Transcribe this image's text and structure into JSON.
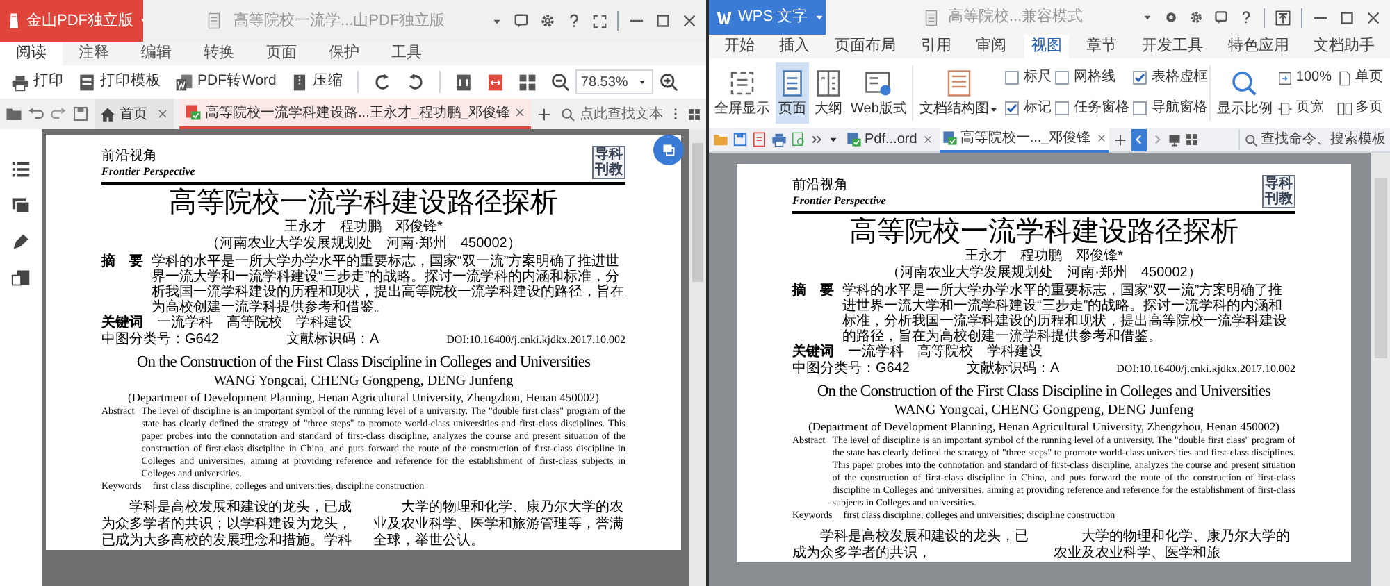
{
  "pdf_window": {
    "app_name": "金山PDF独立版",
    "title": "高等院校一流学...山PDF独立版",
    "ribbon_tabs": [
      {
        "label": "阅读",
        "selected": true
      },
      {
        "label": "注释",
        "selected": false
      },
      {
        "label": "编辑",
        "selected": false
      },
      {
        "label": "转换",
        "selected": false
      },
      {
        "label": "页面",
        "selected": false
      },
      {
        "label": "保护",
        "selected": false
      },
      {
        "label": "工具",
        "selected": false
      }
    ],
    "toolbar": [
      "打印",
      "打印模板",
      "PDF转Word",
      "压缩"
    ],
    "zoom": "78.53%",
    "doc_tabs": [
      {
        "label": "首页",
        "kind": "home",
        "selected": false
      },
      {
        "label": "高等院校一流学科建设路...王永才_程功鹏_邓俊锋",
        "kind": "file",
        "selected": true
      }
    ],
    "search_placeholder": "点此查找文本",
    "document": {
      "section_cn": "前沿视角",
      "section_en": "Frontier Perspective",
      "logo": [
        "导",
        "科",
        "刊",
        "教"
      ],
      "title": "高等院校一流学科建设路径探析",
      "authors": "王永才　程功鹏　邓俊锋*",
      "affiliation": "（河南农业大学发展规划处　河南·郑州　450002）",
      "abstract_label": "摘　要",
      "abstract": "学科的水平是一所大学办学水平的重要标志，国家“双一流”方案明确了推进世界一流大学和一流学科建设“三步走”的战略。探讨一流学科的内涵和标准，分析我国一流学科建设的历程和现状，提出高等院校一流学科建设的路径，旨在为高校创建一流学科提供参考和借鉴。",
      "keywords_label": "关键词",
      "keywords": [
        "一流学科",
        "高等院校",
        "学科建设"
      ],
      "classification": "中图分类号：G642",
      "doc_code": "文献标识码：A",
      "doi": "DOI:10.16400/j.cnki.kjdkx.2017.10.002",
      "en_title": "On the Construction of the First Class Discipline in Colleges and Universities",
      "en_authors": "WANG Yongcai, CHENG Gongpeng, DENG Junfeng",
      "en_affiliation": "(Department of Development Planning, Henan Agricultural University, Zhengzhou, Henan 450002)",
      "en_abstract_label": "Abstract",
      "en_abstract": "The level of discipline is an important symbol of the running level of a university. The \"double first class\" program of the state has clearly defined the strategy of \"three steps\" to promote world-class universities and first-class disciplines. This paper probes into the connotation and standard of first-class discipline, analyzes the course and present situation of the construction of first-class discipline in China, and puts forward the route of the construction of first-class discipline in Colleges and universities, aiming at providing reference and reference for the establishment of first-class subjects in Colleges and universities.",
      "en_keywords_label": "Keywords",
      "en_keywords": "first class discipline; colleges and universities; discipline construction",
      "body_columns": [
        "学科是高校发展和建设的龙头，已成为众多学者的共识；以学科建设为龙头，已成为大多高校的发展理念和措施。学科",
        "大学的物理和化学、康乃尔大学的农业及农业科学、医学和旅游管理等，誉满全球，举世公认。"
      ]
    }
  },
  "wps_window": {
    "app_name": "WPS 文字",
    "title": "高等院校...兼容模式",
    "ribbon_tabs": [
      {
        "label": "开始",
        "selected": false
      },
      {
        "label": "插入",
        "selected": false
      },
      {
        "label": "页面布局",
        "selected": false
      },
      {
        "label": "引用",
        "selected": false
      },
      {
        "label": "审阅",
        "selected": false
      },
      {
        "label": "视图",
        "selected": true
      },
      {
        "label": "章节",
        "selected": false
      },
      {
        "label": "开发工具",
        "selected": false
      },
      {
        "label": "特色应用",
        "selected": false
      },
      {
        "label": "文档助手",
        "selected": false
      }
    ],
    "view_buttons": [
      {
        "label": "全屏显示",
        "selected": false
      },
      {
        "label": "页面",
        "selected": true
      },
      {
        "label": "大纲",
        "selected": false
      },
      {
        "label": "Web版式",
        "selected": false
      }
    ],
    "structure_button": "文档结构图",
    "checkboxes": [
      {
        "label": "标尺",
        "checked": false
      },
      {
        "label": "网格线",
        "checked": false
      },
      {
        "label": "表格虚框",
        "checked": true
      },
      {
        "label": "标记",
        "checked": true
      },
      {
        "label": "任务窗格",
        "checked": false
      },
      {
        "label": "导航窗格",
        "checked": false
      }
    ],
    "zoom_button": "显示比例",
    "zoom_options": [
      "100%",
      "页宽"
    ],
    "page_options": [
      "单页",
      "多页"
    ],
    "doc_tabs": [
      {
        "label": "Pdf...ord",
        "selected": false
      },
      {
        "label": "高等院校一..._邓俊锋",
        "selected": true
      }
    ],
    "search_placeholder": "查找命令、搜索模板",
    "document": {
      "section_cn": "前沿视角",
      "section_en": "Frontier Perspective",
      "logo": [
        "导",
        "科",
        "刊",
        "教"
      ],
      "title": "高等院校一流学科建设路径探析",
      "authors": "王永才　程功鹏　邓俊锋*",
      "affiliation": "（河南农业大学发展规划处　河南·郑州　450002）",
      "abstract_label": "摘　要",
      "abstract": "学科的水平是一所大学办学水平的重要标志，国家“双一流”方案明确了推进世界一流大学和一流学科建设“三步走”的战略。探讨一流学科的内涵和标准，分析我国一流学科建设的历程和现状，提出高等院校一流学科建设的路径，旨在为高校创建一流学科提供参考和借鉴。",
      "keywords_label": "关键词",
      "keywords": [
        "一流学科",
        "高等院校",
        "学科建设"
      ],
      "classification": "中图分类号：G642",
      "doc_code": "文献标识码：A",
      "doi": "DOI:10.16400/j.cnki.kjdkx.2017.10.002",
      "en_title": "On the Construction of the First Class Discipline in Colleges and Universities",
      "en_authors": "WANG Yongcai, CHENG Gongpeng, DENG Junfeng",
      "en_affiliation": "(Department of Development Planning, Henan Agricultural University, Zhengzhou, Henan 450002)",
      "en_abstract_label": "Abstract",
      "en_abstract": "The level of discipline is an important symbol of the running level of a university. The \"double first class\" program of the state has clearly defined the strategy of \"three steps\" to promote world-class universities and first-class disciplines. This paper probes into the connotation and standard of first-class discipline, analyzes the course and present situation of the construction of first-class discipline in China, and puts forward the route of the construction of first-class discipline in Colleges and universities, aiming at providing reference and reference for the establishment of first-class subjects in Colleges and universities.",
      "en_keywords_label": "Keywords",
      "en_keywords": "first class discipline; colleges and universities; discipline construction",
      "body_columns": [
        "学科是高校发展和建设的龙头，已成为众多学者的共识，",
        "大学的物理和化学、康乃尔大学的农业及农业科学、医学和旅"
      ]
    }
  }
}
